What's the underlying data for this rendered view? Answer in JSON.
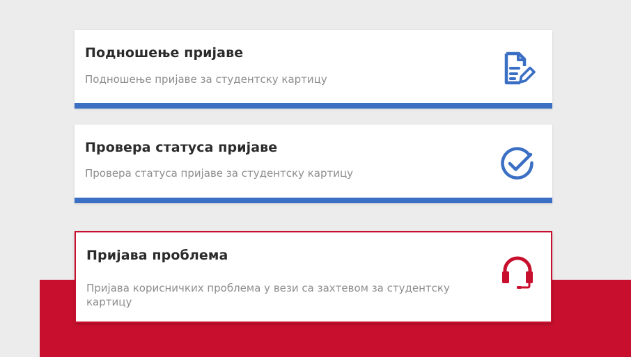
{
  "cards": [
    {
      "title": "Подношење пријаве",
      "description": "Подношење пријаве за студентску картицу",
      "icon": "document-edit-icon"
    },
    {
      "title": "Провера статуса пријаве",
      "description": "Провера статуса пријаве за студентску картицу",
      "icon": "check-circle-icon"
    },
    {
      "title": "Пријава проблема",
      "description": "Пријава корисничких проблема у вези са захтевом за студентску картицу",
      "icon": "headset-icon"
    }
  ],
  "colors": {
    "blue_accent": "#3a6fc4",
    "red_accent": "#c8102e",
    "background": "#ececec"
  }
}
